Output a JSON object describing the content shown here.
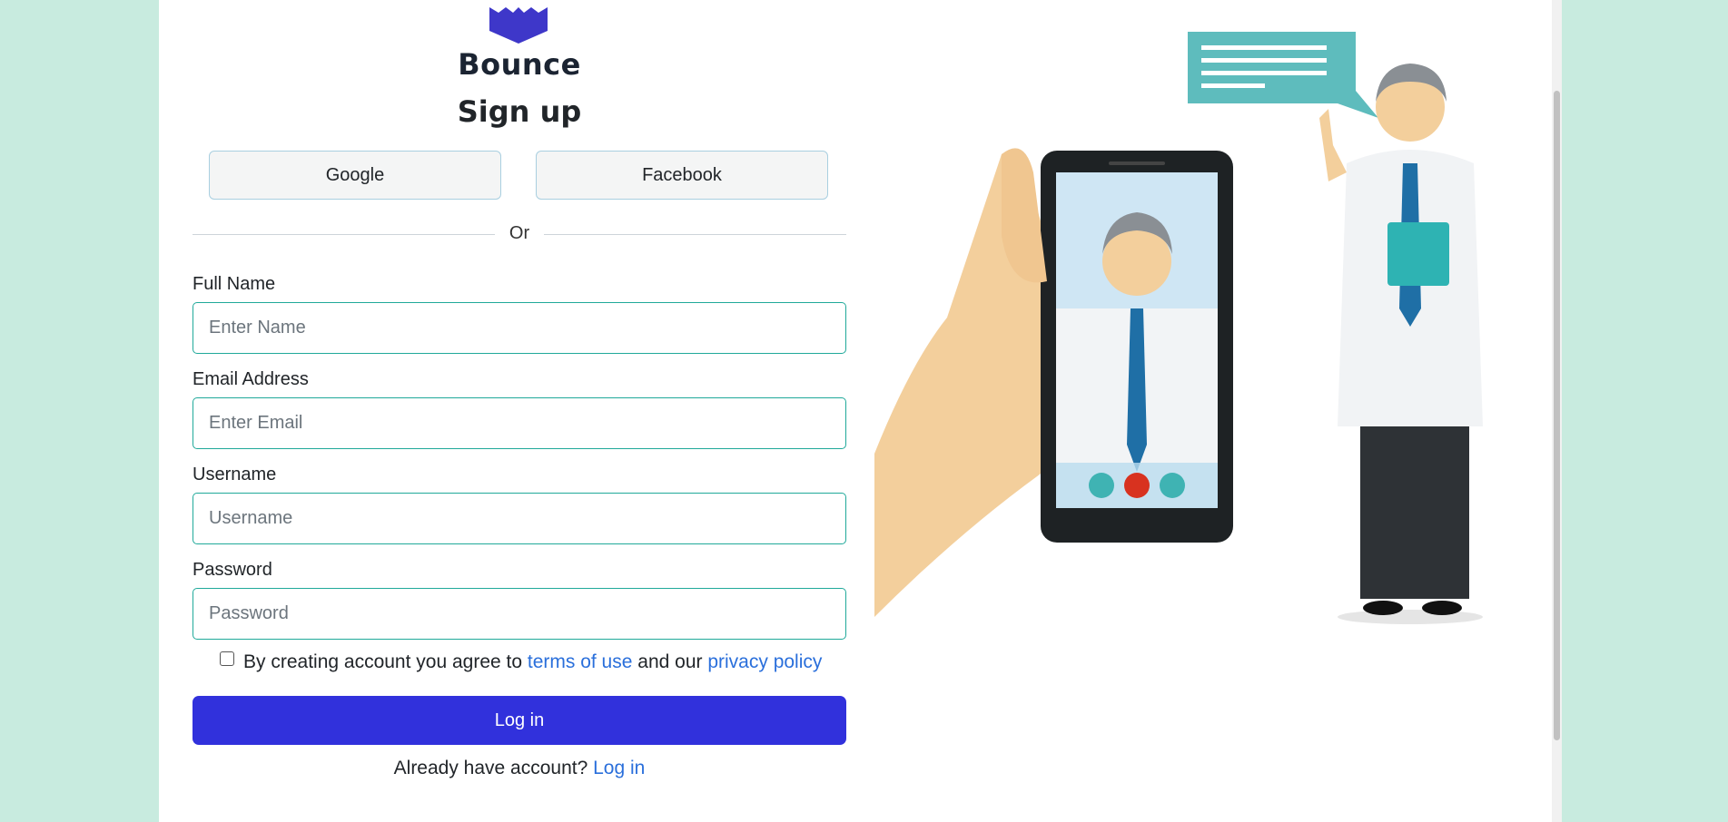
{
  "brand": {
    "name": "Bounce",
    "logo_icon": "crown-logo-icon",
    "logo_color": "#3e37c9"
  },
  "form": {
    "title": "Sign up",
    "social": {
      "google_label": "Google",
      "facebook_label": "Facebook"
    },
    "divider_text": "Or",
    "fields": {
      "full_name": {
        "label": "Full Name",
        "placeholder": "Enter Name",
        "value": ""
      },
      "email": {
        "label": "Email Address",
        "placeholder": "Enter Email",
        "value": ""
      },
      "username": {
        "label": "Username",
        "placeholder": "Username",
        "value": ""
      },
      "password": {
        "label": "Password",
        "placeholder": "Password",
        "value": ""
      }
    },
    "terms": {
      "checked": false,
      "prefix": "By creating account you agree to",
      "terms_link": "terms of use",
      "middle": "and our",
      "privacy_link": "privacy policy"
    },
    "submit_label": "Log in",
    "already": {
      "text": "Already have account?",
      "link": "Log in"
    }
  },
  "illustration": {
    "icon": "doctor-video-call-illustration"
  },
  "colors": {
    "background": "#c8ebdf",
    "primary": "#3131dc",
    "input_border": "#20a99a",
    "link": "#2a6fdb"
  }
}
